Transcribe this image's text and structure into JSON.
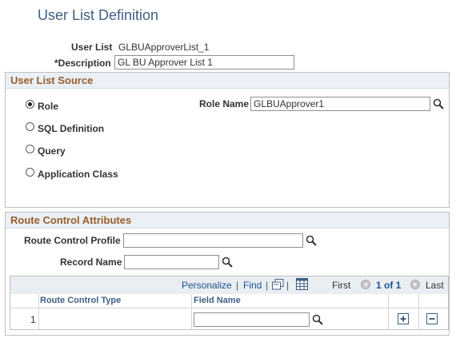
{
  "page": {
    "title": "User List Definition"
  },
  "header": {
    "user_list_label": "User List",
    "user_list_value": "GLBUApproverList_1",
    "description_label": "*Description",
    "description_value": "GL BU Approver List 1"
  },
  "source": {
    "title": "User List Source",
    "options": [
      "Role",
      "SQL Definition",
      "Query",
      "Application Class"
    ],
    "selected": "Role",
    "role_name_label": "Role Name",
    "role_name_value": "GLBUApprover1"
  },
  "route": {
    "title": "Route Control Attributes",
    "profile_label": "Route Control Profile",
    "profile_value": "",
    "record_label": "Record Name",
    "record_value": "",
    "grid": {
      "personalize": "Personalize",
      "find": "Find",
      "separator": "|",
      "first": "First",
      "page_info": "1 of 1",
      "last": "Last",
      "columns": [
        "Route Control Type",
        "Field Name"
      ],
      "rows": [
        {
          "num": "1",
          "route_control_type": "",
          "field_name": ""
        }
      ]
    }
  },
  "colors": {
    "title": "#3e5f85",
    "group_title": "#9a5d2c",
    "link": "#1e4f8f",
    "group_bg": "#eaf0f5"
  }
}
